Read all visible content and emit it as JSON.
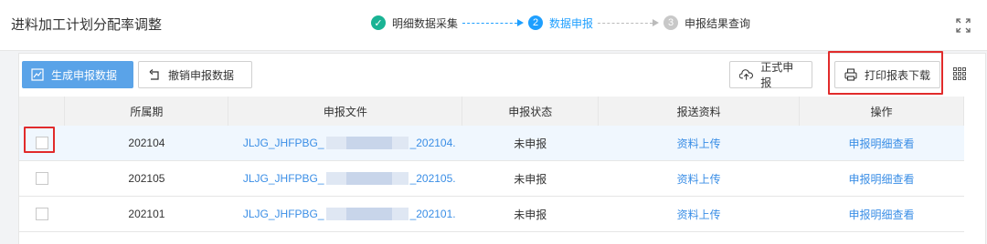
{
  "header": {
    "title": "进料加工计划分配率调整",
    "steps": [
      {
        "num": "✓",
        "label": "明细数据采集"
      },
      {
        "num": "2",
        "label": "数据申报"
      },
      {
        "num": "3",
        "label": "申报结果查询"
      }
    ]
  },
  "toolbar": {
    "generate_label": "生成申报数据",
    "revoke_label": "撤销申报数据",
    "submit_label": "正式申报",
    "print_label": "打印报表下载"
  },
  "table": {
    "columns": [
      "所属期",
      "申报文件",
      "申报状态",
      "报送资料",
      "操作"
    ],
    "rows": [
      {
        "period": "202104",
        "file_prefix": "JLJG_JHFPBG_",
        "file_suffix": "_202104.",
        "status": "未申报",
        "upload": "资料上传",
        "action": "申报明细查看"
      },
      {
        "period": "202105",
        "file_prefix": "JLJG_JHFPBG_",
        "file_suffix": "_202105.",
        "status": "未申报",
        "upload": "资料上传",
        "action": "申报明细查看"
      },
      {
        "period": "202101",
        "file_prefix": "JLJG_JHFPBG_",
        "file_suffix": "_202101.",
        "status": "未申报",
        "upload": "资料上传",
        "action": "申报明细查看"
      }
    ]
  },
  "colors": {
    "primary": "#5aa3e8",
    "step_done": "#1ab394",
    "step_active": "#1e9fff",
    "link": "#3a8ee6",
    "highlight": "#e12b2b"
  },
  "icons": [
    "check-circle-icon",
    "fullscreen-icon",
    "chart-icon",
    "undo-icon",
    "upload-icon",
    "printer-icon",
    "grid-icon"
  ]
}
